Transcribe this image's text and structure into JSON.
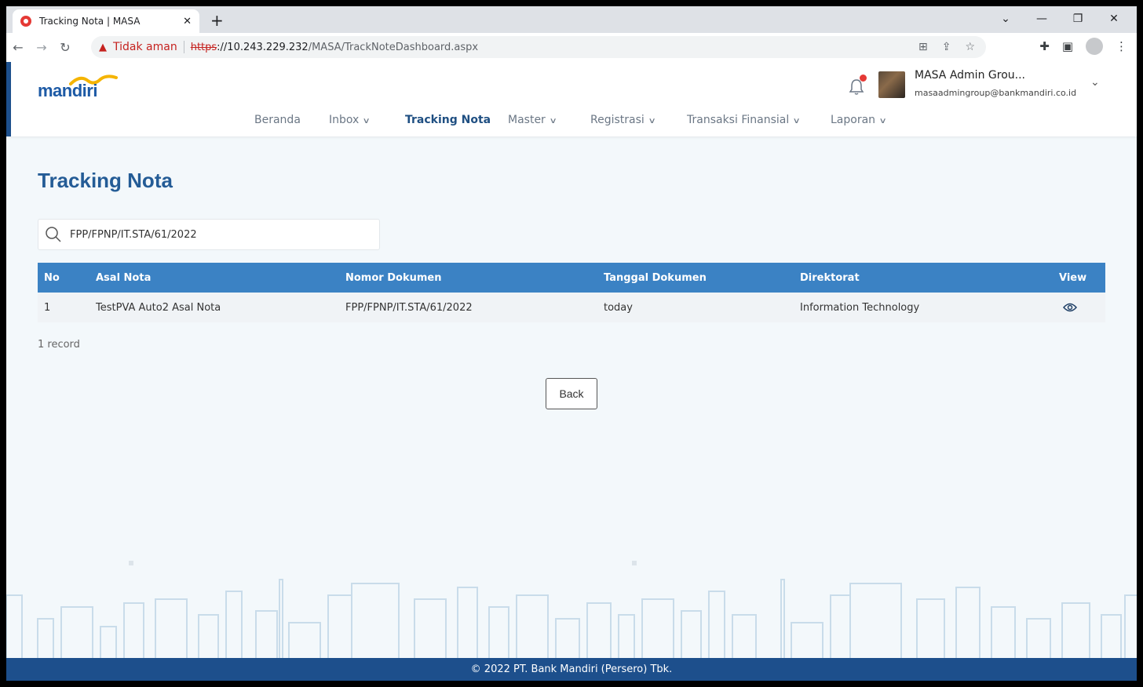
{
  "browser": {
    "tab_title": "Tracking Nota | MASA",
    "tab_close": "✕",
    "new_tab": "+",
    "warning_label": "Tidak aman",
    "url_scheme": "https",
    "url_host": "://10.243.229.232",
    "url_path": "/MASA/TrackNoteDashboard.aspx"
  },
  "header": {
    "logo_text": "mandiri",
    "user_name": "MASA Admin Grou...",
    "user_email": "masaadmingroup@bankmandiri.co.id"
  },
  "nav": {
    "items": [
      {
        "label": "Beranda"
      },
      {
        "label": "Inbox"
      },
      {
        "label": "Tracking Nota"
      },
      {
        "label": "Master"
      },
      {
        "label": "Registrasi"
      },
      {
        "label": "Transaksi Finansial"
      },
      {
        "label": "Laporan"
      }
    ]
  },
  "main": {
    "title": "Tracking Nota",
    "search_value": "FPP/FPNP/IT.STA/61/2022",
    "table": {
      "columns": [
        "No",
        "Asal Nota",
        "Nomor Dokumen",
        "Tanggal Dokumen",
        "Direktorat",
        "View"
      ],
      "rows": [
        [
          "1",
          "TestPVA Auto2 Asal Nota",
          "FPP/FPNP/IT.STA/61/2022",
          "today",
          "Information Technology"
        ]
      ]
    },
    "records_label": "1 record",
    "back_label": "Back"
  },
  "footer": {
    "text": "© 2022 PT. Bank Mandiri (Persero) Tbk."
  },
  "colors": {
    "brand_blue": "#1d4f8c",
    "table_header": "#3b82c4",
    "title": "#245c96",
    "alert_red": "#e53935"
  }
}
